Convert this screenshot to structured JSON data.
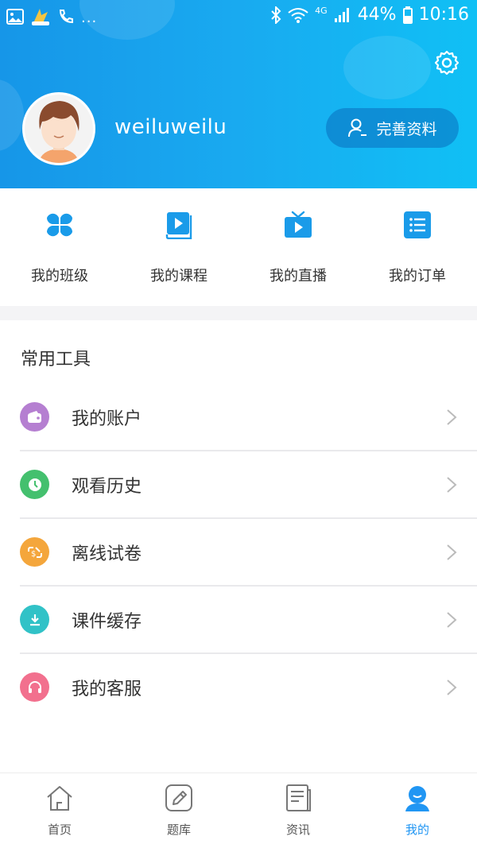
{
  "status_bar": {
    "battery": "44%",
    "time": "10:16",
    "network": "4G",
    "more": "..."
  },
  "header": {
    "username": "weiluweilu",
    "profile_button": "完善资料"
  },
  "quick_actions": [
    {
      "label": "我的班级",
      "icon": "grid-clover-icon"
    },
    {
      "label": "我的课程",
      "icon": "book-play-icon"
    },
    {
      "label": "我的直播",
      "icon": "tv-play-icon"
    },
    {
      "label": "我的订单",
      "icon": "list-icon"
    }
  ],
  "tools": {
    "title": "常用工具",
    "items": [
      {
        "label": "我的账户",
        "icon": "wallet-icon",
        "color": "#b57fd1"
      },
      {
        "label": "观看历史",
        "icon": "clock-icon",
        "color": "#44c06e"
      },
      {
        "label": "离线试卷",
        "icon": "offline-paper-icon",
        "color": "#f4a63c"
      },
      {
        "label": "课件缓存",
        "icon": "download-icon",
        "color": "#31c2c7"
      },
      {
        "label": "我的客服",
        "icon": "headset-icon",
        "color": "#f2708e"
      }
    ]
  },
  "bottom_nav": [
    {
      "label": "首页",
      "icon": "home-icon"
    },
    {
      "label": "题库",
      "icon": "question-bank-icon"
    },
    {
      "label": "资讯",
      "icon": "news-icon"
    },
    {
      "label": "我的",
      "icon": "user-icon",
      "active": true
    }
  ],
  "colors": {
    "header_start": "#1696e8",
    "header_end": "#10c0f5",
    "accent": "#2196f3"
  }
}
